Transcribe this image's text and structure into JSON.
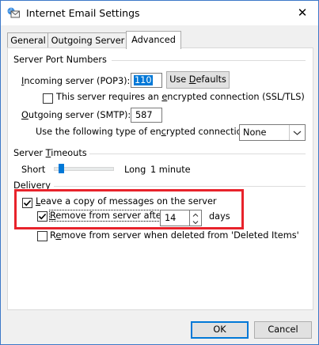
{
  "window": {
    "title": "Internet Email Settings",
    "close_glyph": "✕"
  },
  "tabs": [
    {
      "label": "General"
    },
    {
      "label": "Outgoing Server"
    },
    {
      "label": "Advanced",
      "active": true
    }
  ],
  "server_ports": {
    "group_label": "Server Port Numbers",
    "incoming_label_pre": "I",
    "incoming_label_rest": "ncoming server (POP3):",
    "incoming_value": "110",
    "use_defaults_label_pre": "Use ",
    "use_defaults_label_u": "D",
    "use_defaults_label_post": "efaults",
    "encrypted_label_pre": "This server requires an ",
    "encrypted_label_u": "e",
    "encrypted_label_post": "ncrypted connection (SSL/TLS)",
    "encrypted_checked": false,
    "outgoing_label_pre": "",
    "outgoing_label_u": "O",
    "outgoing_label_post": "utgoing server (SMTP):",
    "outgoing_value": "587",
    "enc_type_label_pre": "Use the following type of en",
    "enc_type_label_u": "c",
    "enc_type_label_post": "rypted connection:",
    "enc_type_value": "None"
  },
  "timeouts": {
    "group_label_pre": "Server ",
    "group_label_u": "T",
    "group_label_post": "imeouts",
    "short_label": "Short",
    "long_label": "Long",
    "value_text": "1 minute",
    "slider_fraction": 0.03
  },
  "delivery": {
    "group_label": "Delivery",
    "leave_copy_label_pre": "",
    "leave_copy_label_u": "L",
    "leave_copy_label_post": "eave a copy of messages on the server",
    "leave_copy_checked": true,
    "remove_after_label_pre": "",
    "remove_after_label_u": "R",
    "remove_after_label_post": "emove from server after",
    "remove_after_checked": true,
    "remove_after_days": "14",
    "days_label": "days",
    "remove_deleted_label_pre": "R",
    "remove_deleted_label_u": "e",
    "remove_deleted_label_post": "move from server when deleted from 'Deleted Items'",
    "remove_deleted_checked": false
  },
  "footer": {
    "ok_label": "OK",
    "cancel_label": "Cancel"
  },
  "colors": {
    "accent": "#0078d7",
    "highlight_border": "#e8232b",
    "window_border": "#3c78c8"
  },
  "icons": {
    "app": "envelope-globe-icon",
    "checkmark": "checkmark-icon",
    "dropdown": "chevron-down-icon",
    "spin_up": "spin-up-icon",
    "spin_down": "spin-down-icon"
  }
}
